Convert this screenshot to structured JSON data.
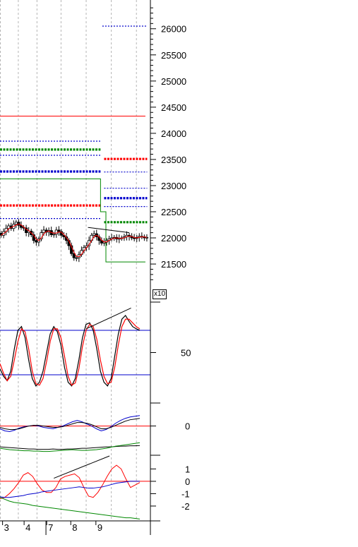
{
  "chart_data": {
    "type": "line",
    "panels": [
      {
        "id": "price",
        "y_ticks": [
          21500,
          22000,
          22500,
          23000,
          23500,
          24000,
          24500,
          25000,
          25500,
          26000
        ],
        "ylim": [
          21150,
          26550
        ],
        "multiplier_label": "x10",
        "candles": {
          "x": [
            0.3,
            1,
            1.7,
            2.4,
            3.1,
            3.8,
            4.5,
            5.2,
            5.9,
            6.6,
            7.3,
            8,
            8.7,
            9.4,
            10.1,
            10.8,
            11.5,
            12.2,
            12.9,
            13.6,
            14.3,
            15,
            15.7,
            16.4,
            17.1,
            17.8,
            18.5,
            19.2,
            19.9,
            20.6,
            21.3,
            22,
            22.7,
            23.4,
            24.1,
            24.8,
            25.5,
            26.2,
            26.9,
            27.6,
            28.3,
            29,
            29.7,
            30.4,
            31.1,
            31.8,
            32.5,
            33.2,
            33.9,
            34.6,
            35.3,
            36,
            36.7,
            37.4,
            38.1,
            38.8,
            39.5,
            40.2,
            40.9
          ],
          "close": [
            22050,
            22120,
            22180,
            22230,
            22180,
            22260,
            22300,
            22240,
            22200,
            22190,
            22100,
            22130,
            22060,
            21950,
            21920,
            21980,
            22100,
            22150,
            22110,
            22140,
            22060,
            22070,
            22150,
            22120,
            22050,
            22020,
            21950,
            21850,
            21700,
            21620,
            21620,
            21680,
            21760,
            21820,
            21850,
            21950,
            22050,
            22080,
            22020,
            21950,
            21900,
            21920,
            21950,
            21980,
            22000,
            22010,
            21980,
            21990,
            22000,
            22020,
            22050,
            22030,
            22000,
            21990,
            22010,
            22030,
            22020,
            22000,
            22010
          ]
        },
        "levels": [
          {
            "name": "",
            "value": 26050,
            "x": [
              28.5,
              41
            ],
            "color": "#0000cc",
            "style": "dotted"
          },
          {
            "name": "",
            "value": 24330,
            "x": [
              0,
              40.5
            ],
            "color": "#ff0000",
            "style": "solid"
          },
          {
            "name": "",
            "value": 23850,
            "x": [
              0,
              28
            ],
            "color": "#0000cc",
            "style": "dotted"
          },
          {
            "name": "",
            "value": 23690,
            "x": [
              0,
              28
            ],
            "color": "#008800",
            "style": "thick-dotted"
          },
          {
            "name": "",
            "value": 23580,
            "x": [
              0,
              28
            ],
            "color": "#0000cc",
            "style": "dotted"
          },
          {
            "name": "",
            "value": 23510,
            "x": [
              29,
              41
            ],
            "color": "#ff0000",
            "style": "thick-dotted"
          },
          {
            "name": "",
            "value": 23270,
            "x": [
              0,
              28
            ],
            "color": "#0000cc",
            "style": "thick-dotted"
          },
          {
            "name": "",
            "value": 23260,
            "x": [
              29,
              41
            ],
            "color": "#0000cc",
            "style": "dotted"
          },
          {
            "name": "",
            "value": 22950,
            "x": [
              29,
              41
            ],
            "color": "#0000cc",
            "style": "dotted"
          },
          {
            "name": "",
            "value": 22760,
            "x": [
              29,
              41
            ],
            "color": "#0000cc",
            "style": "thick-dotted"
          },
          {
            "name": "",
            "value": 22620,
            "x": [
              0,
              28
            ],
            "color": "#ff0000",
            "style": "thick-dotted"
          },
          {
            "name": "",
            "value": 22600,
            "x": [
              29,
              41
            ],
            "color": "#0000cc",
            "style": "dotted"
          },
          {
            "name": "",
            "value": 22370,
            "x": [
              0,
              28
            ],
            "color": "#0000cc",
            "style": "dotted"
          },
          {
            "name": "",
            "value": 22300,
            "x": [
              29,
              41
            ],
            "color": "#008800",
            "style": "thick-dotted"
          }
        ],
        "channel": {
          "color": "#008800",
          "x": [
            0,
            28,
            28,
            29.5,
            29.5,
            40.5
          ],
          "y": [
            23130,
            23130,
            22500,
            22500,
            21540,
            21540
          ]
        },
        "trendline": {
          "color": "#000000",
          "x": [
            24.5,
            36
          ],
          "y": [
            22200,
            22100
          ]
        }
      },
      {
        "id": "stochastic",
        "y_ticks": [
          50
        ],
        "ylim": [
          -18,
          118
        ],
        "levels": [
          80,
          20
        ],
        "level_color": "#0000cc",
        "k": [
          28,
          18,
          12,
          25,
          55,
          80,
          85,
          70,
          40,
          15,
          5,
          10,
          25,
          50,
          75,
          85,
          78,
          60,
          30,
          10,
          5,
          15,
          40,
          70,
          88,
          90,
          80,
          55,
          25,
          10,
          5,
          15,
          45,
          75,
          95,
          100,
          92,
          85,
          82,
          80
        ],
        "d": [
          35,
          22,
          12,
          18,
          40,
          65,
          82,
          78,
          55,
          25,
          8,
          6,
          15,
          38,
          65,
          82,
          82,
          70,
          45,
          18,
          6,
          9,
          28,
          58,
          80,
          88,
          85,
          68,
          40,
          18,
          8,
          10,
          30,
          60,
          85,
          95,
          95,
          90,
          85,
          82
        ],
        "k_color": "#000000",
        "d_color": "#ff0000",
        "trendline": {
          "color": "#000000",
          "x": [
            24,
            36.5
          ],
          "y": [
            82,
            110
          ]
        }
      },
      {
        "id": "indicator-3",
        "y_ticks": [
          0
        ],
        "ylim": [
          -3,
          3
        ],
        "zero_line_color": "#ff0000",
        "series": [
          {
            "name": "",
            "color": "#0000cc",
            "values": [
              -0.4,
              -0.7,
              -0.8,
              -0.6,
              -0.3,
              -0.1,
              0.0,
              0.1,
              0.0,
              -0.2,
              -0.3,
              -0.4,
              -0.2,
              0.0,
              0.3,
              0.6,
              0.8,
              0.6,
              0.3,
              0.0,
              -0.4,
              -0.7,
              -0.5,
              -0.1,
              0.4,
              0.8,
              1.1,
              1.3,
              1.4,
              1.5
            ]
          },
          {
            "name": "",
            "color": "#000000",
            "values": [
              -0.2,
              -0.4,
              -0.5,
              -0.5,
              -0.4,
              -0.2,
              0.0,
              0.1,
              0.1,
              0.0,
              -0.1,
              -0.2,
              -0.2,
              -0.1,
              0.1,
              0.3,
              0.5,
              0.5,
              0.4,
              0.2,
              -0.1,
              -0.4,
              -0.4,
              -0.2,
              0.1,
              0.4,
              0.7,
              0.9,
              1.0,
              1.1
            ]
          },
          {
            "name": "",
            "color": "#000000",
            "values": [
              -3.0,
              -3.05,
              -3.1,
              -3.15,
              -3.2,
              -3.25,
              -3.3,
              -3.3,
              -3.35,
              -3.35,
              -3.35,
              -3.3,
              -3.35,
              -3.35,
              -3.3,
              -3.3,
              -3.25,
              -3.2,
              -3.2,
              -3.15,
              -3.1,
              -3.05,
              -3.0,
              -3.0,
              -2.95,
              -2.9,
              -2.9,
              -2.85,
              -2.85,
              -2.8
            ]
          },
          {
            "name": "",
            "color": "#008800",
            "values": [
              -3.2,
              -3.3,
              -3.4,
              -3.45,
              -3.5,
              -3.55,
              -3.55,
              -3.6,
              -3.6,
              -3.65,
              -3.65,
              -3.6,
              -3.55,
              -3.5,
              -3.45,
              -3.4,
              -3.45,
              -3.5,
              -3.5,
              -3.45,
              -3.4,
              -3.3,
              -3.2,
              -3.05,
              -2.9,
              -2.8,
              -2.7,
              -2.6,
              -2.5,
              -2.4
            ]
          }
        ]
      },
      {
        "id": "indicator-4",
        "y_ticks": [
          1,
          0,
          -1,
          -2
        ],
        "ylim": [
          -3,
          1.5
        ],
        "zero_line_color": "#ff0000",
        "series": [
          {
            "name": "",
            "color": "#ff0000",
            "values": [
              -1.4,
              -1.3,
              -1.0,
              -0.6,
              -0.1,
              0.5,
              0.7,
              0.4,
              -0.2,
              -0.7,
              -0.9,
              -0.9,
              -0.5,
              0.2,
              0.4,
              0.5,
              0.6,
              0.3,
              -0.5,
              -1.2,
              -1.3,
              -0.9,
              -0.3,
              0.4,
              1.0,
              1.3,
              1.0,
              0.2,
              -0.5,
              -0.3,
              -0.1
            ]
          },
          {
            "name": "",
            "color": "#0000cc",
            "values": [
              -1.25,
              -1.3,
              -1.3,
              -1.25,
              -1.2,
              -1.15,
              -1.05,
              -1.0,
              -0.95,
              -0.85,
              -0.8,
              -0.75,
              -0.7,
              -0.65,
              -0.6,
              -0.55,
              -0.5,
              -0.45,
              -0.5,
              -0.55,
              -0.55,
              -0.5,
              -0.45,
              -0.35,
              -0.25,
              -0.15,
              -0.1,
              -0.05,
              0.0,
              0.0,
              0.0
            ]
          },
          {
            "name": "",
            "color": "#008800",
            "values": [
              -1.3,
              -1.45,
              -1.6,
              -1.7,
              -1.75,
              -1.8,
              -1.85,
              -1.95,
              -2.0,
              -2.05,
              -2.1,
              -2.15,
              -2.2,
              -2.25,
              -2.3,
              -2.35,
              -2.4,
              -2.45,
              -2.5,
              -2.55,
              -2.6,
              -2.65,
              -2.7,
              -2.75,
              -2.8,
              -2.85,
              -2.9,
              -2.95,
              -2.95,
              -3.0,
              -3.05
            ]
          },
          {
            "name": "",
            "color": "#000000",
            "values": [
              0.1,
              2.1
            ]
          }
        ],
        "trendline": {
          "color": "#000000",
          "x": [
            15,
            30.5
          ],
          "y": [
            0.25,
            2.05
          ]
        }
      }
    ],
    "x_axis": {
      "date_labels": [
        "3",
        "4",
        "7",
        "8",
        "9"
      ],
      "label_positions": [
        1.5,
        7.5,
        13.8,
        20.5,
        27.5
      ]
    },
    "grid": {
      "vertical_dashed": true
    }
  }
}
